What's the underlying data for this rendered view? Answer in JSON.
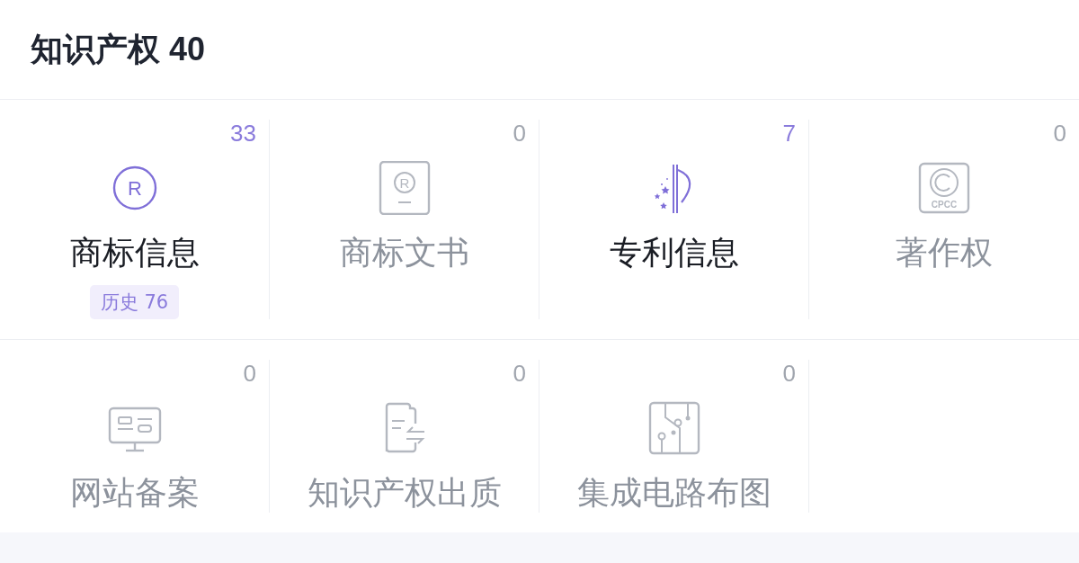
{
  "title": "知识产权 40",
  "items": [
    {
      "label": "商标信息",
      "count": "33",
      "disabled": false,
      "icon": {
        "kind": "circle-letter",
        "text": "R"
      },
      "badge": "历史 76"
    },
    {
      "label": "商标文书",
      "count": "0",
      "disabled": true,
      "icon": {
        "kind": "registered-doc",
        "text": "R"
      }
    },
    {
      "label": "专利信息",
      "count": "7",
      "disabled": false,
      "icon": {
        "kind": "patent"
      }
    },
    {
      "label": "著作权",
      "count": "0",
      "disabled": true,
      "icon": {
        "kind": "copyright",
        "text": "CPCC"
      }
    },
    {
      "label": "网站备案",
      "count": "0",
      "disabled": true,
      "icon": {
        "kind": "monitor"
      }
    },
    {
      "label": "知识产权出质",
      "count": "0",
      "disabled": true,
      "icon": {
        "kind": "doc-exchange"
      }
    },
    {
      "label": "集成电路布图",
      "count": "0",
      "disabled": true,
      "icon": {
        "kind": "circuit"
      }
    }
  ]
}
